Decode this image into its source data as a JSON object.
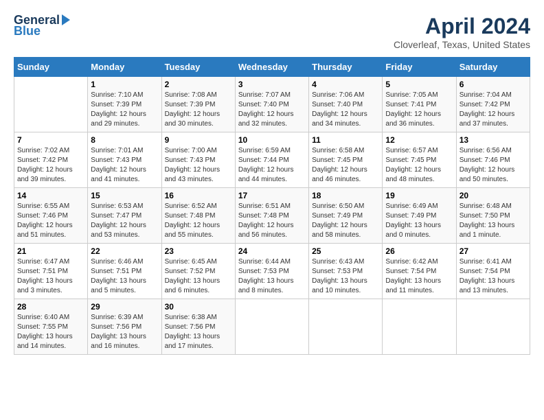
{
  "logo": {
    "line1": "General",
    "line2": "Blue"
  },
  "title": "April 2024",
  "subtitle": "Cloverleaf, Texas, United States",
  "days_of_week": [
    "Sunday",
    "Monday",
    "Tuesday",
    "Wednesday",
    "Thursday",
    "Friday",
    "Saturday"
  ],
  "weeks": [
    [
      {
        "day": "",
        "info": ""
      },
      {
        "day": "1",
        "info": "Sunrise: 7:10 AM\nSunset: 7:39 PM\nDaylight: 12 hours\nand 29 minutes."
      },
      {
        "day": "2",
        "info": "Sunrise: 7:08 AM\nSunset: 7:39 PM\nDaylight: 12 hours\nand 30 minutes."
      },
      {
        "day": "3",
        "info": "Sunrise: 7:07 AM\nSunset: 7:40 PM\nDaylight: 12 hours\nand 32 minutes."
      },
      {
        "day": "4",
        "info": "Sunrise: 7:06 AM\nSunset: 7:40 PM\nDaylight: 12 hours\nand 34 minutes."
      },
      {
        "day": "5",
        "info": "Sunrise: 7:05 AM\nSunset: 7:41 PM\nDaylight: 12 hours\nand 36 minutes."
      },
      {
        "day": "6",
        "info": "Sunrise: 7:04 AM\nSunset: 7:42 PM\nDaylight: 12 hours\nand 37 minutes."
      }
    ],
    [
      {
        "day": "7",
        "info": "Sunrise: 7:02 AM\nSunset: 7:42 PM\nDaylight: 12 hours\nand 39 minutes."
      },
      {
        "day": "8",
        "info": "Sunrise: 7:01 AM\nSunset: 7:43 PM\nDaylight: 12 hours\nand 41 minutes."
      },
      {
        "day": "9",
        "info": "Sunrise: 7:00 AM\nSunset: 7:43 PM\nDaylight: 12 hours\nand 43 minutes."
      },
      {
        "day": "10",
        "info": "Sunrise: 6:59 AM\nSunset: 7:44 PM\nDaylight: 12 hours\nand 44 minutes."
      },
      {
        "day": "11",
        "info": "Sunrise: 6:58 AM\nSunset: 7:45 PM\nDaylight: 12 hours\nand 46 minutes."
      },
      {
        "day": "12",
        "info": "Sunrise: 6:57 AM\nSunset: 7:45 PM\nDaylight: 12 hours\nand 48 minutes."
      },
      {
        "day": "13",
        "info": "Sunrise: 6:56 AM\nSunset: 7:46 PM\nDaylight: 12 hours\nand 50 minutes."
      }
    ],
    [
      {
        "day": "14",
        "info": "Sunrise: 6:55 AM\nSunset: 7:46 PM\nDaylight: 12 hours\nand 51 minutes."
      },
      {
        "day": "15",
        "info": "Sunrise: 6:53 AM\nSunset: 7:47 PM\nDaylight: 12 hours\nand 53 minutes."
      },
      {
        "day": "16",
        "info": "Sunrise: 6:52 AM\nSunset: 7:48 PM\nDaylight: 12 hours\nand 55 minutes."
      },
      {
        "day": "17",
        "info": "Sunrise: 6:51 AM\nSunset: 7:48 PM\nDaylight: 12 hours\nand 56 minutes."
      },
      {
        "day": "18",
        "info": "Sunrise: 6:50 AM\nSunset: 7:49 PM\nDaylight: 12 hours\nand 58 minutes."
      },
      {
        "day": "19",
        "info": "Sunrise: 6:49 AM\nSunset: 7:49 PM\nDaylight: 13 hours\nand 0 minutes."
      },
      {
        "day": "20",
        "info": "Sunrise: 6:48 AM\nSunset: 7:50 PM\nDaylight: 13 hours\nand 1 minute."
      }
    ],
    [
      {
        "day": "21",
        "info": "Sunrise: 6:47 AM\nSunset: 7:51 PM\nDaylight: 13 hours\nand 3 minutes."
      },
      {
        "day": "22",
        "info": "Sunrise: 6:46 AM\nSunset: 7:51 PM\nDaylight: 13 hours\nand 5 minutes."
      },
      {
        "day": "23",
        "info": "Sunrise: 6:45 AM\nSunset: 7:52 PM\nDaylight: 13 hours\nand 6 minutes."
      },
      {
        "day": "24",
        "info": "Sunrise: 6:44 AM\nSunset: 7:53 PM\nDaylight: 13 hours\nand 8 minutes."
      },
      {
        "day": "25",
        "info": "Sunrise: 6:43 AM\nSunset: 7:53 PM\nDaylight: 13 hours\nand 10 minutes."
      },
      {
        "day": "26",
        "info": "Sunrise: 6:42 AM\nSunset: 7:54 PM\nDaylight: 13 hours\nand 11 minutes."
      },
      {
        "day": "27",
        "info": "Sunrise: 6:41 AM\nSunset: 7:54 PM\nDaylight: 13 hours\nand 13 minutes."
      }
    ],
    [
      {
        "day": "28",
        "info": "Sunrise: 6:40 AM\nSunset: 7:55 PM\nDaylight: 13 hours\nand 14 minutes."
      },
      {
        "day": "29",
        "info": "Sunrise: 6:39 AM\nSunset: 7:56 PM\nDaylight: 13 hours\nand 16 minutes."
      },
      {
        "day": "30",
        "info": "Sunrise: 6:38 AM\nSunset: 7:56 PM\nDaylight: 13 hours\nand 17 minutes."
      },
      {
        "day": "",
        "info": ""
      },
      {
        "day": "",
        "info": ""
      },
      {
        "day": "",
        "info": ""
      },
      {
        "day": "",
        "info": ""
      }
    ]
  ]
}
